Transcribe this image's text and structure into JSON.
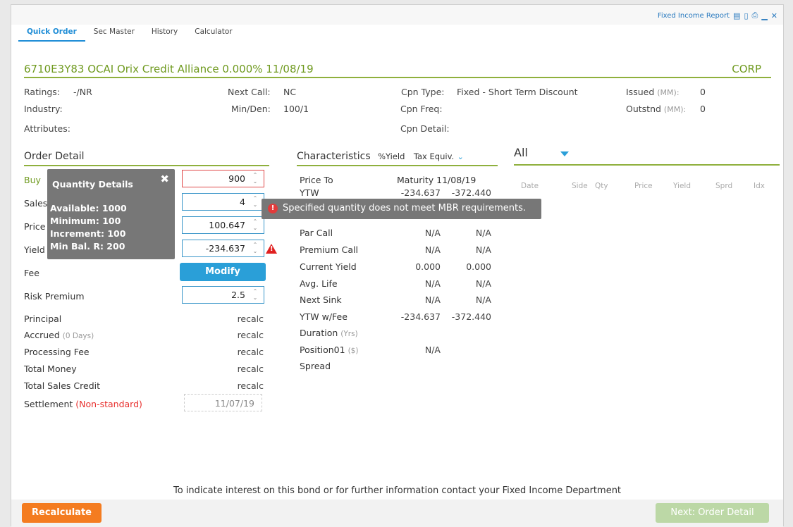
{
  "window": {
    "title": "Fixed Income Report",
    "icons": [
      "report-icon",
      "mobile-icon",
      "print-icon",
      "minimize-icon",
      "close-icon"
    ]
  },
  "tabs": [
    {
      "label": "Quick Order",
      "active": true
    },
    {
      "label": "Sec Master"
    },
    {
      "label": "History"
    },
    {
      "label": "Calculator"
    }
  ],
  "security": {
    "title": "6710E3Y83  OCAI Orix Credit Alliance   0.000%   11/08/19",
    "type": "CORP"
  },
  "info": {
    "ratings_label": "Ratings:",
    "ratings_value": "-/NR",
    "industry_label": "Industry:",
    "attributes_label": "Attributes:",
    "next_call_label": "Next Call:",
    "next_call_value": "NC",
    "min_den_label": "Min/Den:",
    "min_den_value": "100/1",
    "cpn_type_label": "Cpn Type:",
    "cpn_type_value": "Fixed - Short Term Discount",
    "cpn_freq_label": "Cpn Freq:",
    "cpn_detail_label": "Cpn Detail:",
    "issued_label": "Issued",
    "issued_unit": "(MM):",
    "issued_value": "0",
    "outstnd_label": "Outstnd",
    "outstnd_unit": "(MM):",
    "outstnd_value": "0"
  },
  "order_detail": {
    "title": "Order Detail",
    "buy_label": "Buy",
    "sales_label": "Sales",
    "price_label": "Price",
    "yield_label": "Yield",
    "fee_label": "Fee",
    "risk_premium_label": "Risk Premium",
    "principal_label": "Principal",
    "accrued_label": "Accrued",
    "accrued_sub": "(0 Days)",
    "processing_fee_label": "Processing Fee",
    "total_money_label": "Total Money",
    "total_sales_credit_label": "Total Sales Credit",
    "settlement_label": "Settlement",
    "settlement_flag": "(Non-standard)",
    "quantity": "900",
    "sales_credit": "4",
    "price": "100.647",
    "yield": "-234.637",
    "modify_label": "Modify",
    "risk_premium": "2.5",
    "recalc": "recalc",
    "settlement_date": "11/07/19"
  },
  "quantity_popup": {
    "title": "Quantity Details",
    "available": "Available:  1000",
    "minimum": "Minimum:   100",
    "increment": "Increment:  100",
    "min_bal": "Min Bal. R:  200"
  },
  "error_tooltip": "Specified quantity does not meet MBR requirements.",
  "characteristics": {
    "title": "Characteristics",
    "yield_option": "%Yield",
    "tax_option": "Tax Equiv.",
    "header_price_to": "Price To",
    "header_maturity": "Maturity  11/08/19",
    "ytw_label": "YTW",
    "ytw_val1": "-234.637",
    "ytw_val2": "-372.440",
    "rows": [
      {
        "label": "Par Call",
        "v1": "N/A",
        "v2": "N/A"
      },
      {
        "label": "Premium Call",
        "v1": "N/A",
        "v2": "N/A"
      },
      {
        "label": "Current Yield",
        "v1": "0.000",
        "v2": "0.000"
      },
      {
        "label": "Avg. Life",
        "v1": "N/A",
        "v2": "N/A"
      },
      {
        "label": "Next Sink",
        "v1": "N/A",
        "v2": "N/A"
      },
      {
        "label": "YTW w/Fee",
        "v1": "-234.637",
        "v2": "-372.440"
      }
    ],
    "duration_label": "Duration",
    "duration_unit": "(Yrs)",
    "position_label": "Position01",
    "position_unit": "($)",
    "position_val": "N/A",
    "spread_label": "Spread"
  },
  "trades": {
    "filter": "All",
    "columns": [
      "Date",
      "Side",
      "Qty",
      "Price",
      "Yield",
      "Sprd",
      "Idx"
    ]
  },
  "footer_note": "To indicate interest on this bond or for further information contact your Fixed Income Department",
  "buttons": {
    "recalculate": "Recalculate",
    "next": "Next: Order Detail"
  },
  "colors": {
    "accent_green": "#8fb03d",
    "accent_blue": "#2a9fd8",
    "orange": "#f47c20",
    "error_red": "#e02020"
  }
}
